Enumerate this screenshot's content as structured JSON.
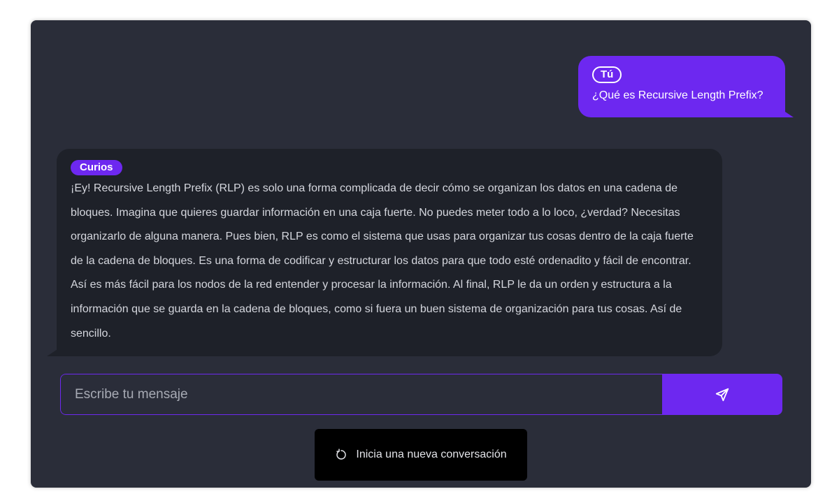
{
  "conversation": {
    "user_message": {
      "sender": "Tú",
      "text": "¿Qué es Recursive Length Prefix?"
    },
    "bot_message": {
      "sender": "Curios",
      "text": "¡Ey! Recursive Length Prefix (RLP) es solo una forma complicada de decir cómo se organizan los datos en una cadena de bloques. Imagina que quieres guardar información en una caja fuerte. No puedes meter todo a lo loco, ¿verdad? Necesitas organizarlo de alguna manera. Pues bien, RLP es como el sistema que usas para organizar tus cosas dentro de la caja fuerte de la cadena de bloques. Es una forma de codificar y estructurar los datos para que todo esté ordenadito y fácil de encontrar. Así es más fácil para los nodos de la red entender y procesar la información. Al final, RLP le da un orden y estructura a la información que se guarda en la cadena de bloques, como si fuera un buen sistema de organización para tus cosas. Así de sencillo."
    }
  },
  "composer": {
    "placeholder": "Escribe tu mensaje",
    "value": "",
    "send_icon": "send-paper-plane-icon"
  },
  "new_conversation": {
    "label": "Inicia una nueva conversación",
    "icon": "refresh-icon"
  },
  "colors": {
    "accent": "#6d28f0",
    "panel_bg": "#2a2d39",
    "bot_bubble_bg": "#1e2129",
    "page_bg": "#ffffff"
  }
}
